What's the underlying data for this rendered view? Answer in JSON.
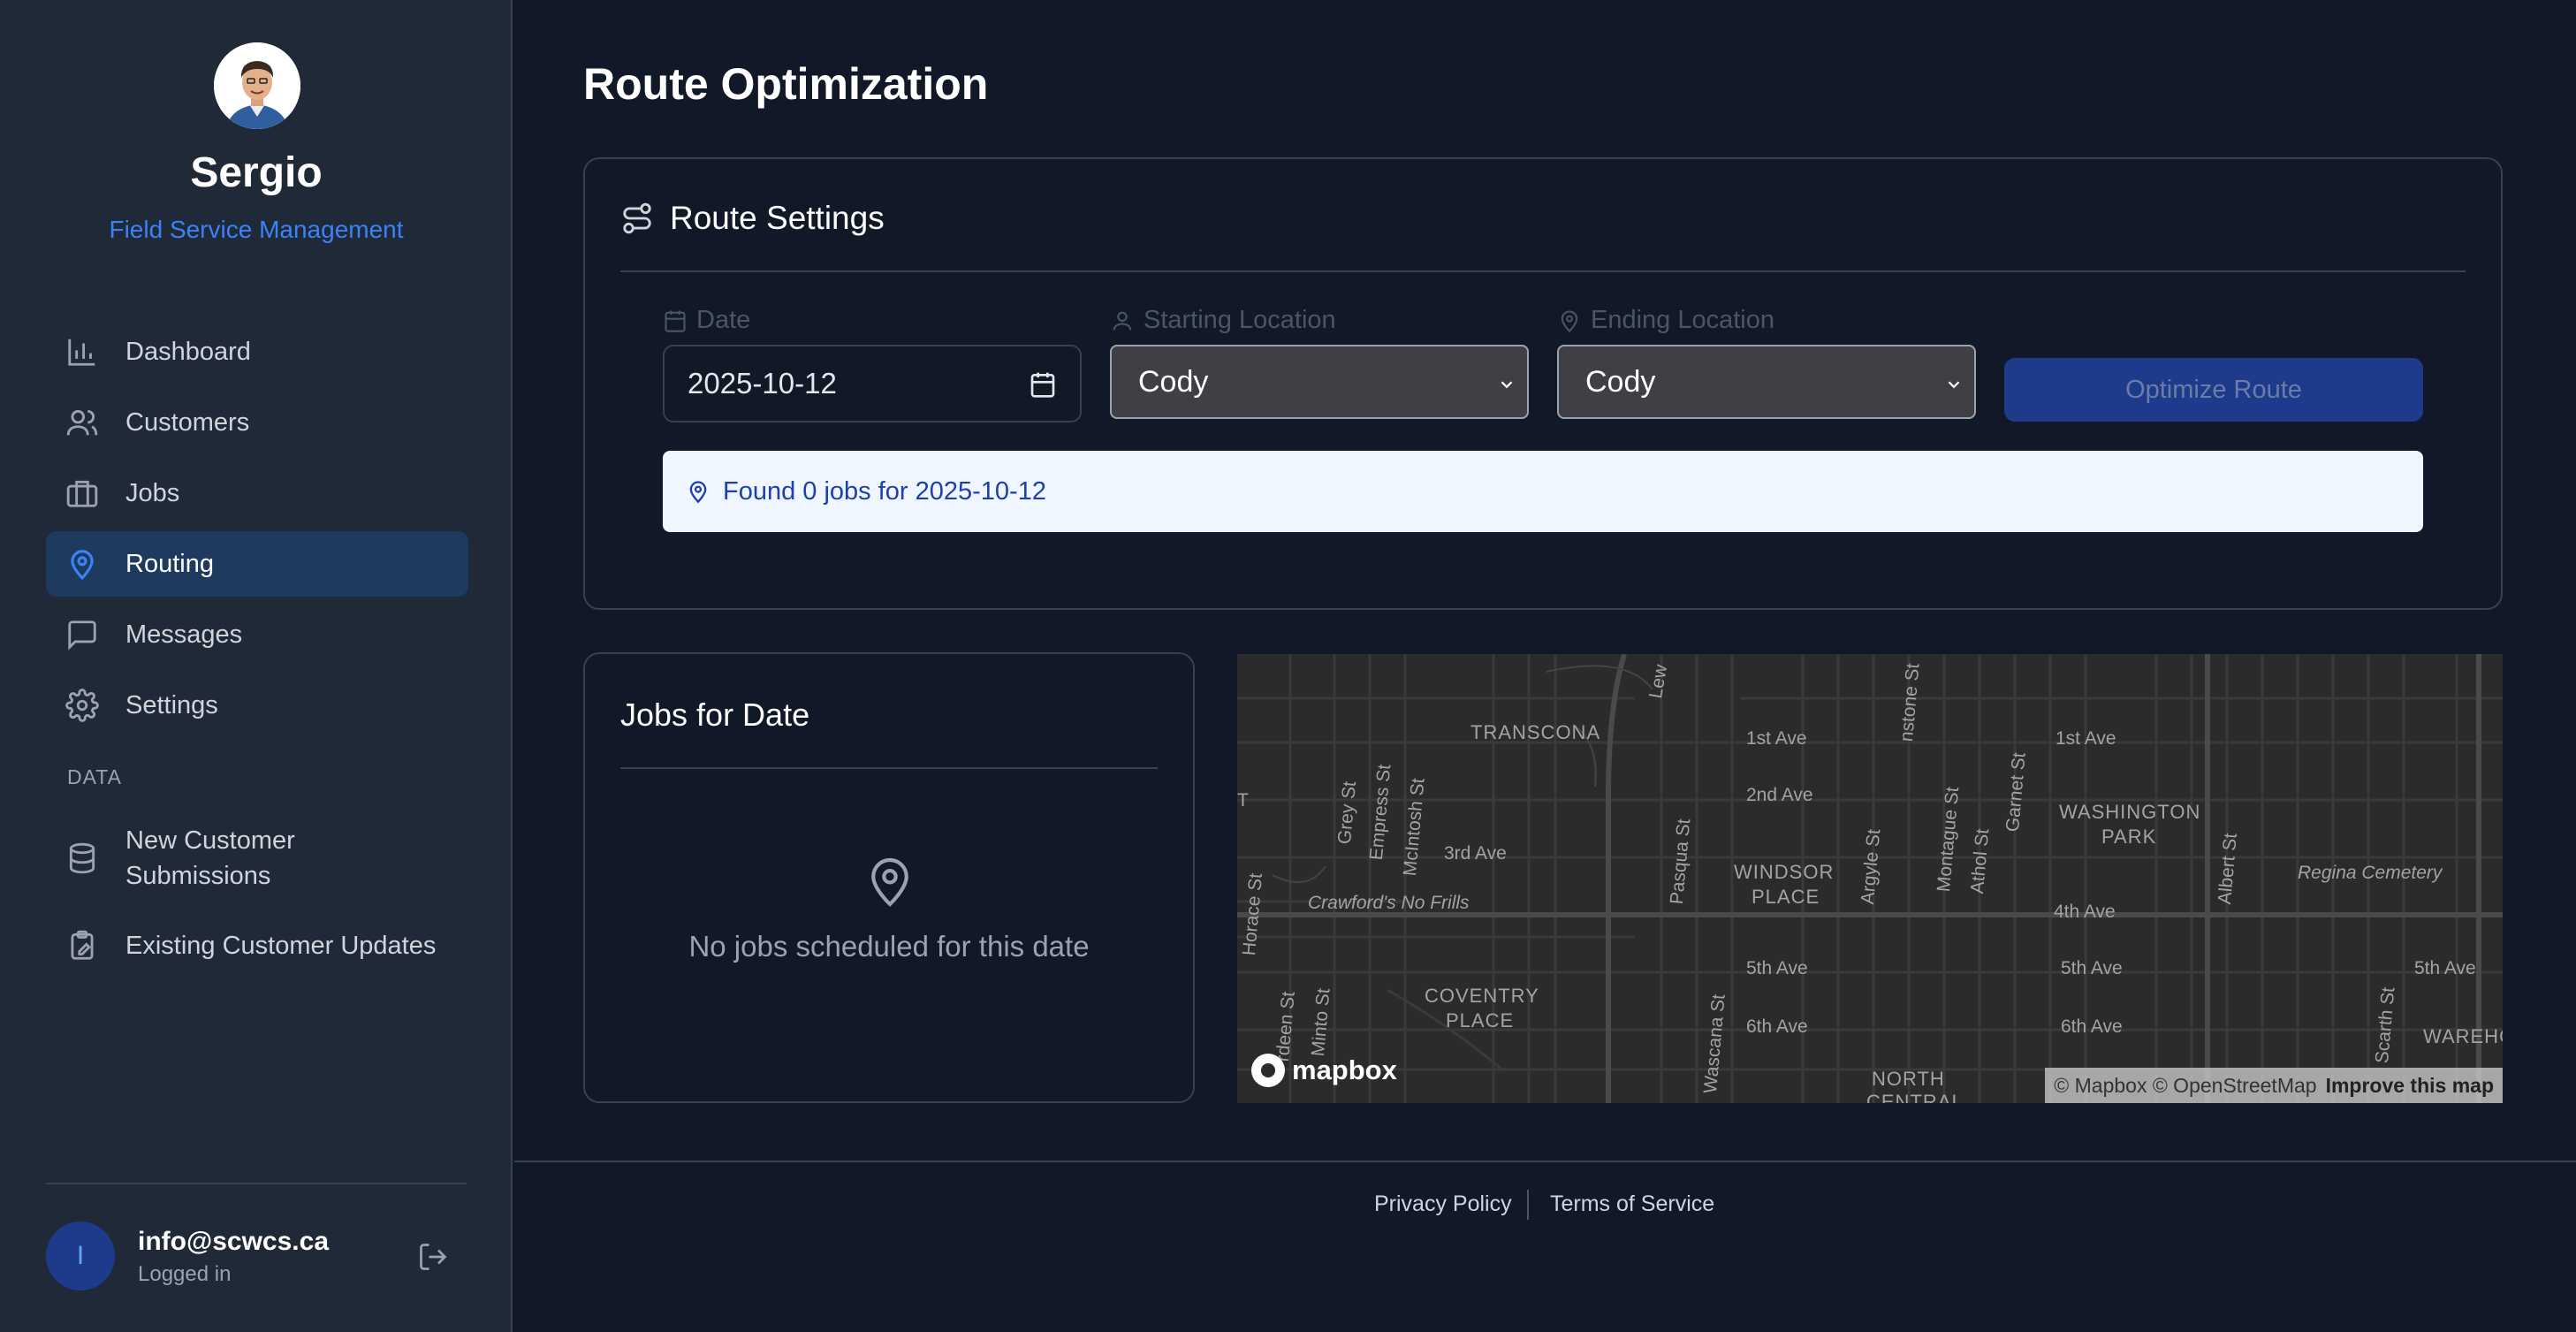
{
  "user": {
    "name": "Sergio",
    "role": "Field Service Management",
    "email": "info@scwcs.ca",
    "status": "Logged in",
    "initial": "I"
  },
  "nav": {
    "items": [
      {
        "label": "Dashboard",
        "icon": "bar-chart-icon"
      },
      {
        "label": "Customers",
        "icon": "users-icon"
      },
      {
        "label": "Jobs",
        "icon": "briefcase-icon"
      },
      {
        "label": "Routing",
        "icon": "map-pin-icon",
        "active": true
      },
      {
        "label": "Messages",
        "icon": "message-square-icon"
      },
      {
        "label": "Settings",
        "icon": "gear-icon"
      }
    ],
    "section_label": "DATA",
    "data_items": [
      {
        "label": "New Customer Submissions",
        "icon": "database-icon"
      },
      {
        "label": "Existing Customer Updates",
        "icon": "clipboard-edit-icon"
      }
    ]
  },
  "page": {
    "title": "Route Optimization"
  },
  "settings": {
    "title": "Route Settings",
    "date_label": "Date",
    "date_value": "2025-10-12",
    "start_label": "Starting Location",
    "start_value": "Cody",
    "end_label": "Ending Location",
    "end_value": "Cody",
    "optimize_label": "Optimize Route",
    "info_text": "Found 0 jobs for 2025-10-12"
  },
  "jobs": {
    "title": "Jobs for Date",
    "empty_text": "No jobs scheduled for this date"
  },
  "map": {
    "logo_text": "mapbox",
    "attribution": "© Mapbox © OpenStreetMap",
    "improve": "Improve this map",
    "labels": {
      "transcona": "TRANSCONA",
      "windsor1": "WINDSOR",
      "windsor2": "PLACE",
      "washington1": "WASHINGTON",
      "washington2": "PARK",
      "coventry1": "COVENTRY",
      "coventry2": "PLACE",
      "north": "NORTH",
      "central": "CENTRAL",
      "cemetery": "Regina Cemetery",
      "frills": "Crawford's No Frills",
      "ave1a": "1st Ave",
      "ave1b": "1st Ave",
      "ave2": "2nd Ave",
      "ave3": "3rd Ave",
      "ave4": "4th Ave",
      "ave5a": "5th Ave",
      "ave5b": "5th Ave",
      "ave5c": "5th Ave",
      "ave6a": "6th Ave",
      "ave6b": "6th Ave",
      "wareho": "WAREHO",
      "lew": "Lew",
      "grey": "Grey St",
      "empress": "Empress St",
      "mcintosh": "McIntosh St",
      "pasqua": "Pasqua St",
      "argyle": "Argyle St",
      "montague": "Montague St",
      "athol": "Athol St",
      "garnet": "Garnet St",
      "albert": "Albert St",
      "stone": "nstone St",
      "wascana": "Wascana St",
      "minto": "Minto St",
      "rdeen": "rdeen St",
      "scarth": "Scarth St",
      "horace": "Horace St",
      "t": "T"
    }
  },
  "footer": {
    "privacy": "Privacy Policy",
    "terms": "Terms of Service"
  },
  "colors": {
    "accent": "#3b82f6",
    "sidebar_bg": "#1f2937",
    "main_bg": "#111827",
    "active_nav": "#1e3a5f",
    "button": "#1e3a8a",
    "info_bg": "#eff6ff"
  }
}
